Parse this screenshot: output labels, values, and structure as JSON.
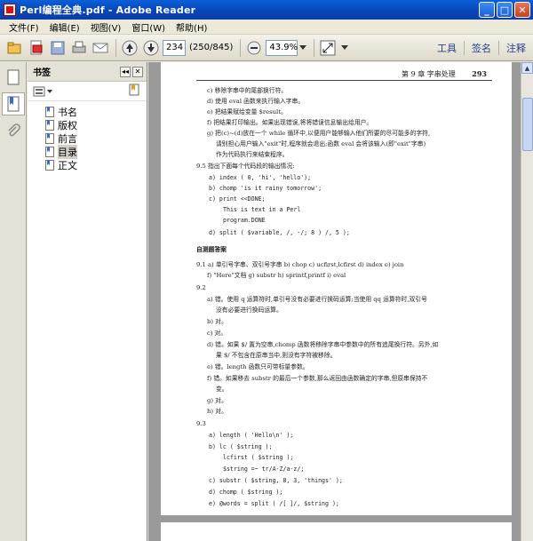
{
  "window": {
    "title": "Perl编程全典.pdf - Adobe Reader"
  },
  "menu": [
    "文件(F)",
    "编辑(E)",
    "视图(V)",
    "窗口(W)",
    "帮助(H)"
  ],
  "toolbar": {
    "page_value": "234",
    "page_info": "(250/845)",
    "zoom_value": "43.9%",
    "tools_label": "工具",
    "sign_label": "签名",
    "comment_label": "注释"
  },
  "bookmarks": {
    "header": "书签",
    "items": [
      {
        "label": "书名"
      },
      {
        "label": "版权"
      },
      {
        "label": "前言"
      },
      {
        "label": "目录"
      },
      {
        "label": "正文"
      }
    ]
  },
  "page": {
    "chapter": "第 9 章  字串处理",
    "number": "293",
    "lines": [
      "c) 移除字串中的尾部换行符。",
      "d) 使用 eval 函数来执行输入字串。",
      "e) 把结果赋给变量 $result。",
      "f) 把结果打印输出。如果出现错误,将将错误信息输出给用户。",
      "g) 把(c)~(d)放在一个 while 循环中,以便用户能够输入他们所要的尽可能多的字符,",
      "请别担心用户输入\"exit\"时,程序就会退出;函数 eval 会将该输入(即\"exit\"字串)",
      "作为代码执行来结束程序。",
      "9.5 指出下面每个代码段的输出情况:",
      "a)  index ( 0, 'hi', 'hello');",
      "b)  chomp 'is it rainy tomorrow';",
      "c)  print <<DONE;",
      "     This is text in a Perl",
      "     program.DONE",
      "d)  split ( $variable, /, -/; 8 ) /, 5 );",
      "自测题答案",
      "9.1 a) 单引号字串、双引号字串   b) chop   c) ucfirst,lcfirst   d) index   e) join",
      "f) \"Here\"文档   g) substr   h) sprintf,printf   i) eval",
      "9.2",
      "a) 错。使用 q 运算符时,单引号没有必要进行换码运算;当使用 qq 运算符时,双引号",
      "没有必要进行换码运算。",
      "b) 对。",
      "c) 对。",
      "d) 错。如果 $/ 置为空串,chomp 函数将移除字串中参数中的所有追尾换行符。另外,如",
      "果 $/ 不包含在原串当中,则没有字符被移除。",
      "e) 错。length 函数只可带标量参数。",
      "f) 错。如果移去 substr 的最后一个参数,那么返回由函数确定的字串,但原串保持不",
      "变。",
      "g) 对。",
      "h) 对。",
      "9.3",
      "a)   length ( 'Hello\\n' );",
      "b)   lc ( $string );",
      "      lcfirst ( $string );",
      "      $string =~ tr/A-Z/a-z/;",
      "c)   substr ( $string, 8, 3, 'things' );",
      "d)   chomp ( $string );",
      "e)   @words = split ( /[ ]/, $string );"
    ]
  }
}
